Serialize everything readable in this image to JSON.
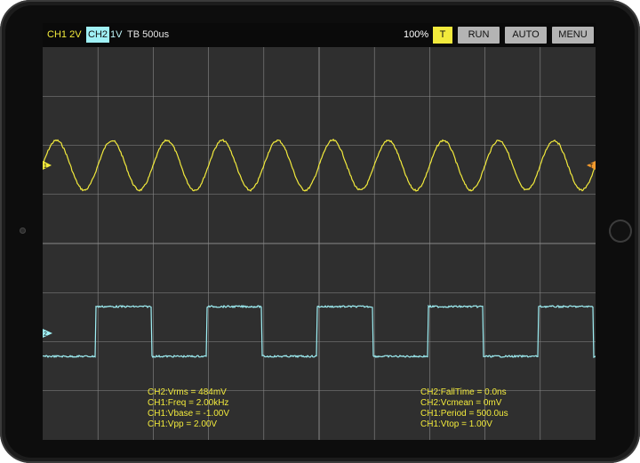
{
  "topbar": {
    "ch1_label": "CH1",
    "ch1_scale": "2V",
    "ch2_label": "CH2",
    "ch2_scale": "1V",
    "timebase": "TB 500us",
    "zoom": "100%",
    "trigger_label": "T",
    "run_label": "RUN",
    "auto_label": "AUTO",
    "menu_label": "MENU"
  },
  "colors": {
    "ch1": "#f2ea3c",
    "ch2": "#9ff0f5",
    "grid": "#8a8a8a",
    "screen_bg": "#2f2f2f",
    "button": "#b4b4b4"
  },
  "markers": {
    "ch1_marker_icon": "ch1-ground-marker",
    "ch2_marker_icon": "ch2-ground-marker",
    "trigger_marker_icon": "trigger-level-marker",
    "ch1_marker_text": "1",
    "ch2_marker_text": "2",
    "trigger_marker_text": "T"
  },
  "measurements": {
    "left": [
      "CH2:Vrms = 484mV",
      "CH1:Freq = 2.00kHz",
      "CH1:Vbase = -1.00V",
      "CH1:Vpp = 2.00V"
    ],
    "right": [
      "CH2:FallTime = 0.0ns",
      "CH2:Vcmean = 0mV",
      "CH1:Period = 500.0us",
      "CH1:Vtop = 1.00V"
    ]
  },
  "waveforms": {
    "ch1": {
      "shape": "sine",
      "cycles_on_screen": 10
    },
    "ch2": {
      "shape": "square",
      "cycles_on_screen": 5
    }
  }
}
